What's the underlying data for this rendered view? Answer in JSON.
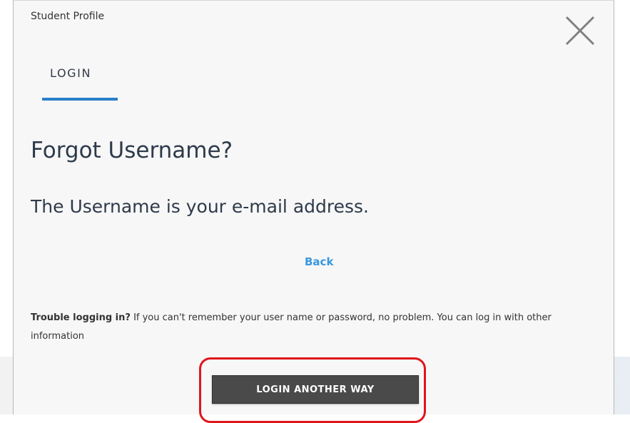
{
  "modal": {
    "title": "Student Profile",
    "close_icon": "close-x-icon"
  },
  "tabs": [
    {
      "label": "LOGIN",
      "active": true
    }
  ],
  "content": {
    "heading": "Forgot Username?",
    "message": "The Username is your e-mail address.",
    "back_link": "Back",
    "trouble_bold": "Trouble logging in?",
    "trouble_text": " If you can't remember your user name or password, no problem. You can log in with other information",
    "alt_login_button": "LOGIN ANOTHER WAY"
  },
  "colors": {
    "accent": "#2a7fc9",
    "link": "#3897e0",
    "heading_text": "#2e3a4b",
    "button_bg": "#4a4a4a",
    "highlight": "#e0161c",
    "modal_bg": "#f7f7f7"
  }
}
